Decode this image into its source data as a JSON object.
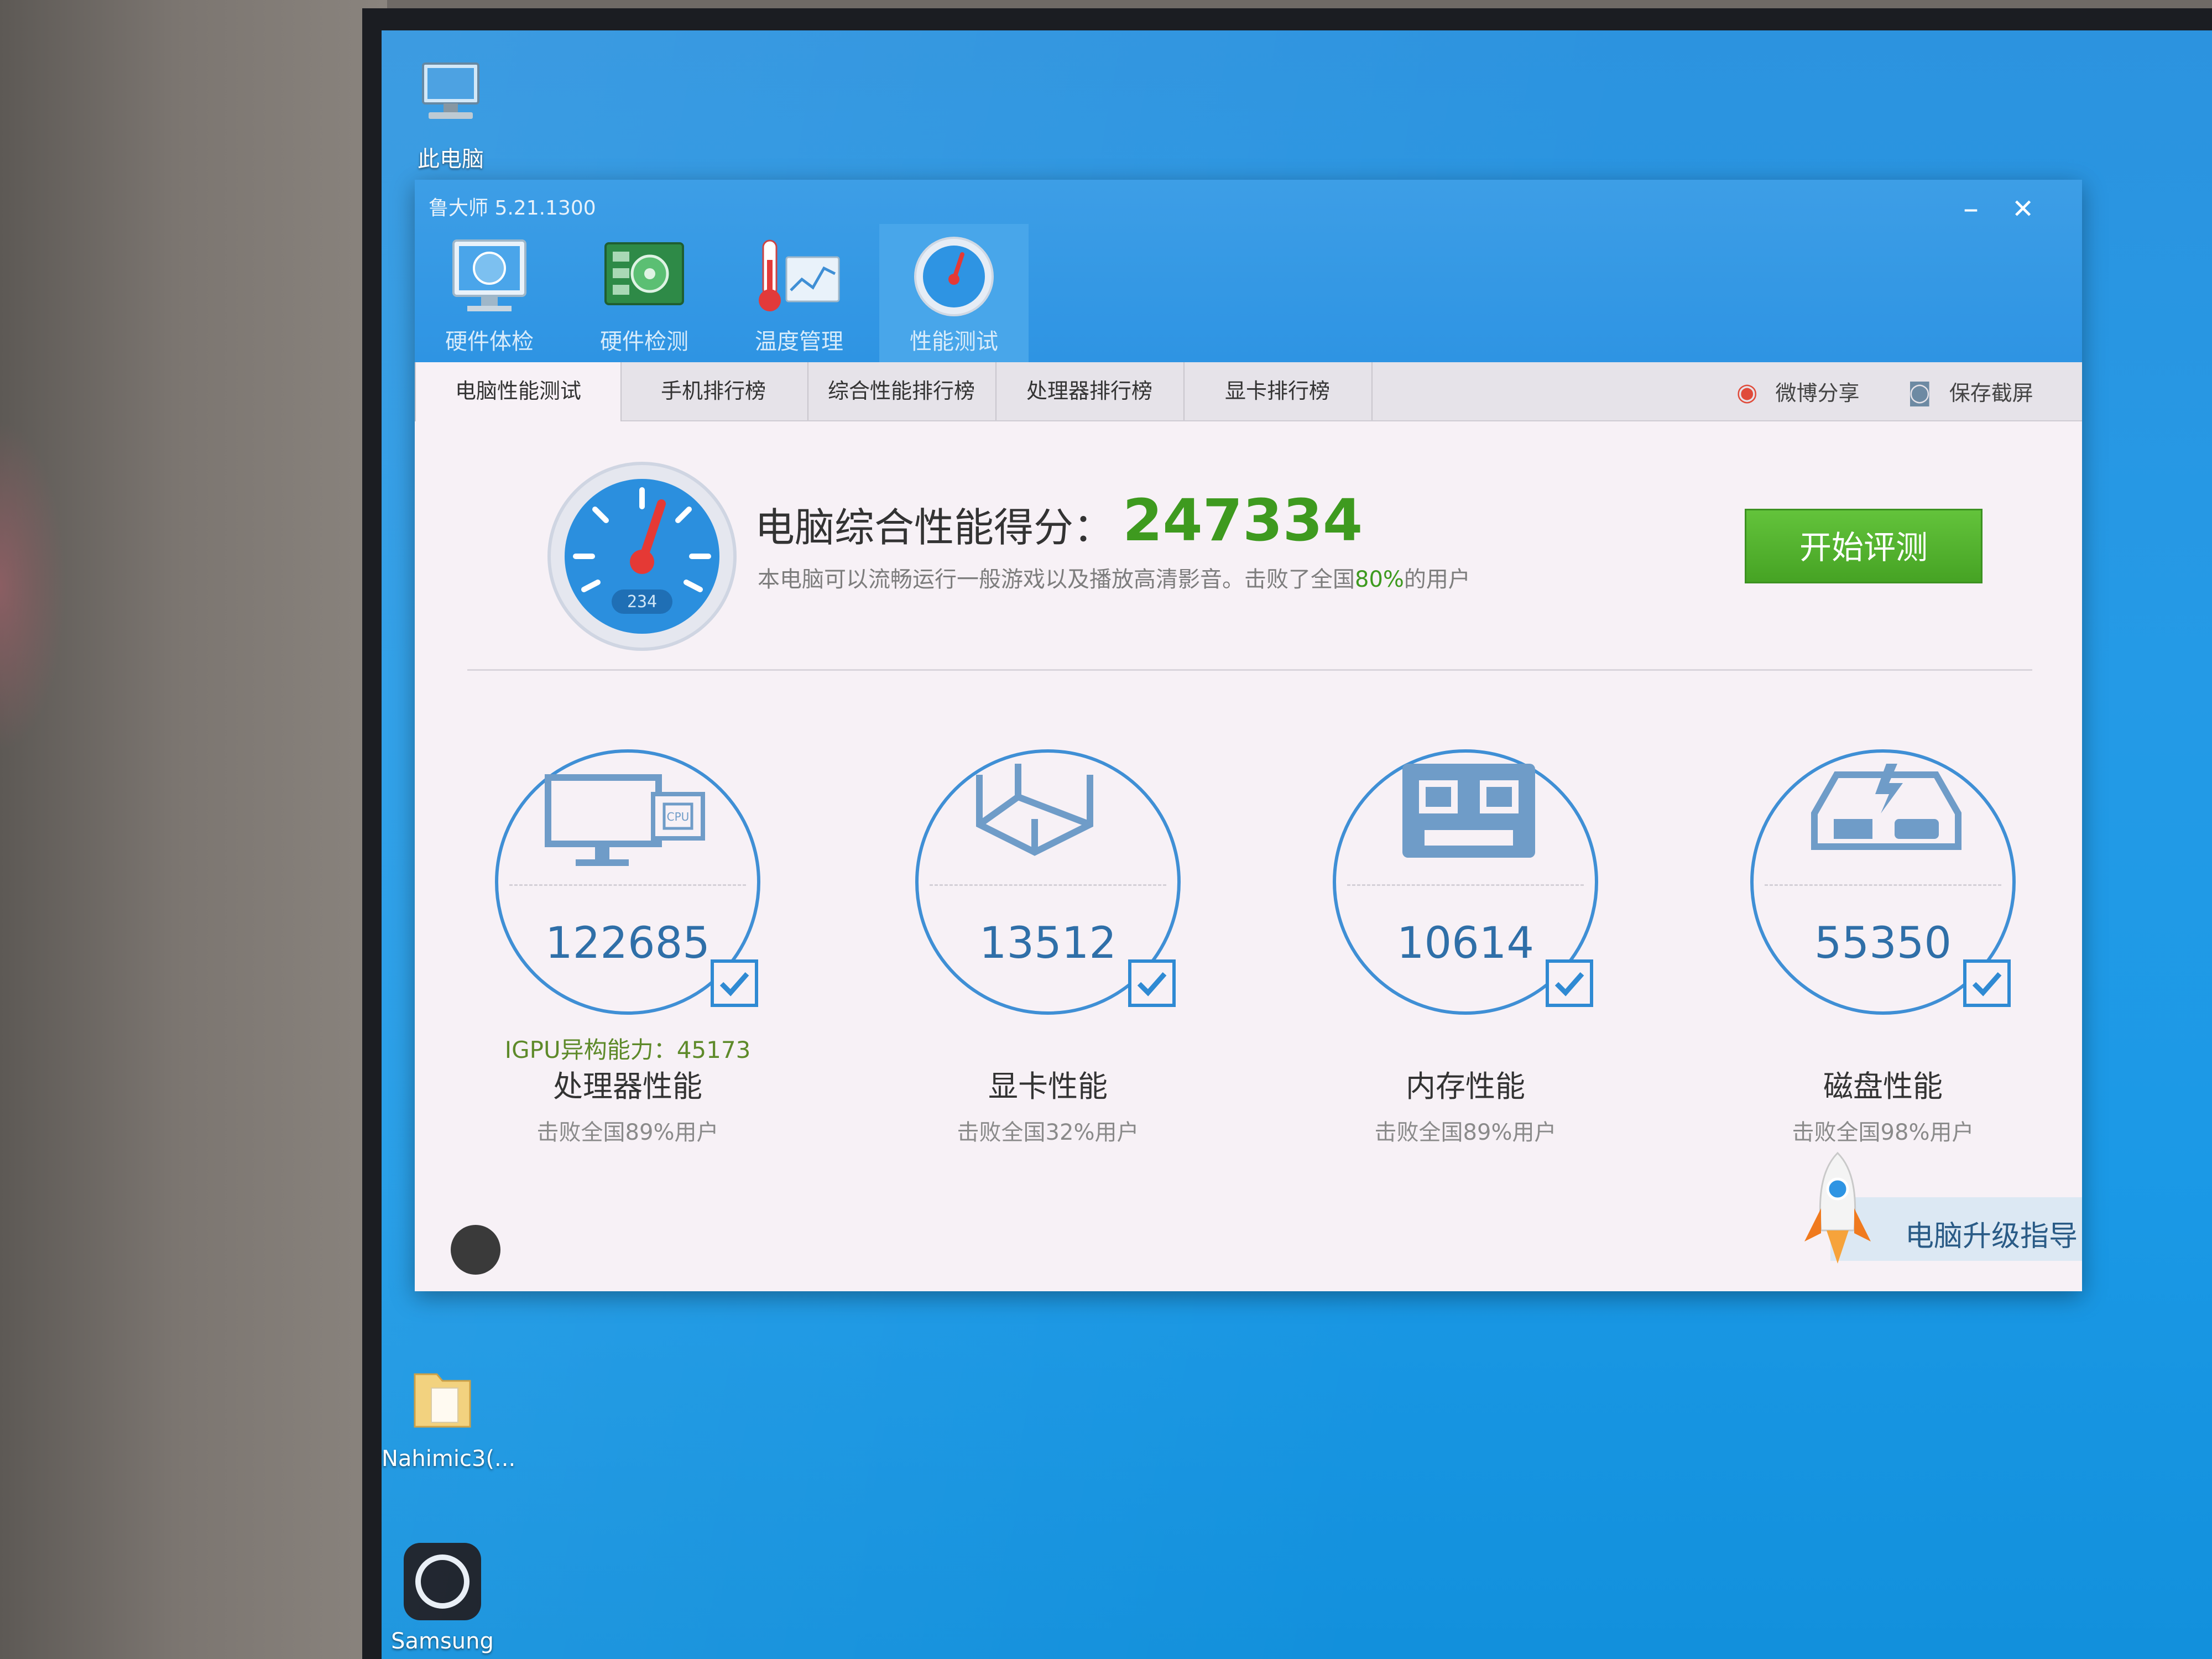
{
  "desktop": {
    "icons": [
      {
        "label": "此电脑"
      },
      {
        "label": "Nahimic3(..."
      },
      {
        "label": "Samsung"
      }
    ]
  },
  "window": {
    "title": "鲁大师 5.21.1300",
    "minimize": "–",
    "close": "✕"
  },
  "nav": [
    {
      "label": "硬件体检",
      "icon": "monitor-check-icon"
    },
    {
      "label": "硬件检测",
      "icon": "circuit-board-icon"
    },
    {
      "label": "温度管理",
      "icon": "thermometer-icon"
    },
    {
      "label": "性能测试",
      "icon": "speedometer-icon"
    }
  ],
  "tabs": [
    {
      "label": "电脑性能测试"
    },
    {
      "label": "手机排行榜"
    },
    {
      "label": "综合性能排行榜"
    },
    {
      "label": "处理器排行榜"
    },
    {
      "label": "显卡排行榜"
    }
  ],
  "tools": {
    "weibo": "微博分享",
    "screenshot": "保存截屏"
  },
  "score": {
    "gauge_readout": "234",
    "label": "电脑综合性能得分：",
    "value": "247334",
    "desc_prefix": "本电脑可以流畅运行一般游戏以及播放高清影音。击败了全国",
    "desc_percent": "80%",
    "desc_suffix": "的用户",
    "start_button": "开始评测"
  },
  "categories": [
    {
      "name": "处理器性能",
      "score": "122685",
      "beat": "击败全国89%用户",
      "icon": "cpu-monitor-icon",
      "extra": "IGPU异构能力：45173"
    },
    {
      "name": "显卡性能",
      "score": "13512",
      "beat": "击败全国32%用户",
      "icon": "graphics-cube-icon"
    },
    {
      "name": "内存性能",
      "score": "10614",
      "beat": "击败全国89%用户",
      "icon": "memory-chip-icon"
    },
    {
      "name": "磁盘性能",
      "score": "55350",
      "beat": "击败全国98%用户",
      "icon": "disk-drive-icon"
    }
  ],
  "upgrade": {
    "label": "电脑升级指导"
  },
  "colors": {
    "accent_blue": "#2e94e3",
    "score_green": "#3e9a1f",
    "button_green": "#46a324"
  }
}
